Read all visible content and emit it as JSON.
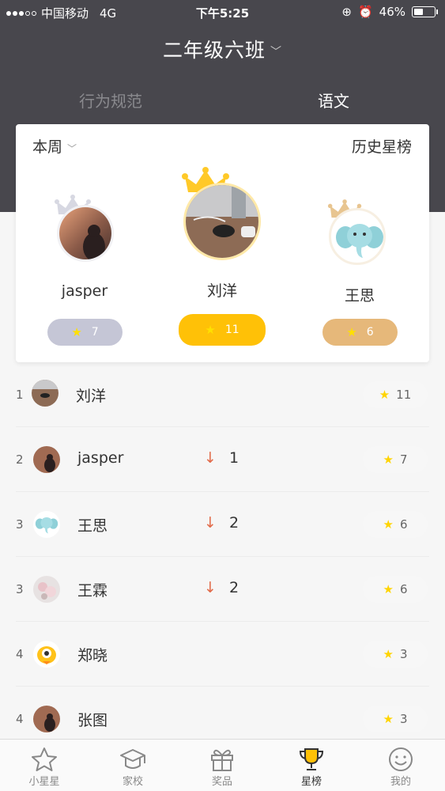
{
  "status_bar": {
    "carrier": "中国移动",
    "network": "4G",
    "time": "下午5:25",
    "battery": "46%"
  },
  "header": {
    "class_name": "二年级六班",
    "tabs": [
      {
        "label": "行为规范",
        "active": false
      },
      {
        "label": "语文",
        "active": true
      }
    ]
  },
  "card": {
    "period": "本周",
    "history": "历史星榜",
    "podium": [
      {
        "name": "jasper",
        "score": "7",
        "place": "second"
      },
      {
        "name": "刘洋",
        "score": "11",
        "place": "first"
      },
      {
        "name": "王思",
        "score": "6",
        "place": "third"
      }
    ]
  },
  "ranking": [
    {
      "rank": "1",
      "name": "刘洋",
      "arrow": "",
      "change": "",
      "score": "11",
      "avatar": "desk"
    },
    {
      "rank": "2",
      "name": "jasper",
      "arrow": "↓",
      "change": "1",
      "score": "7",
      "avatar": "cat"
    },
    {
      "rank": "3",
      "name": "王思",
      "arrow": "↓",
      "change": "2",
      "score": "6",
      "avatar": "elephant"
    },
    {
      "rank": "3",
      "name": "王霖",
      "arrow": "↓",
      "change": "2",
      "score": "6",
      "avatar": "flowers"
    },
    {
      "rank": "4",
      "name": "郑晓",
      "arrow": "",
      "change": "",
      "score": "3",
      "avatar": "chick"
    },
    {
      "rank": "4",
      "name": "张图",
      "arrow": "",
      "change": "",
      "score": "3",
      "avatar": "cat"
    }
  ],
  "tab_bar": [
    {
      "label": "小星星",
      "icon": "star-icon",
      "active": false
    },
    {
      "label": "家校",
      "icon": "graduation-cap-icon",
      "active": false
    },
    {
      "label": "奖品",
      "icon": "gift-icon",
      "active": false
    },
    {
      "label": "星榜",
      "icon": "trophy-icon",
      "active": true
    },
    {
      "label": "我的",
      "icon": "smiley-icon",
      "active": false
    }
  ],
  "colors": {
    "header_bg": "#48474d",
    "gold": "#ffc107",
    "silver": "#c5c6d6",
    "bronze": "#e6b87a",
    "arrow_down": "#e26b4a"
  }
}
